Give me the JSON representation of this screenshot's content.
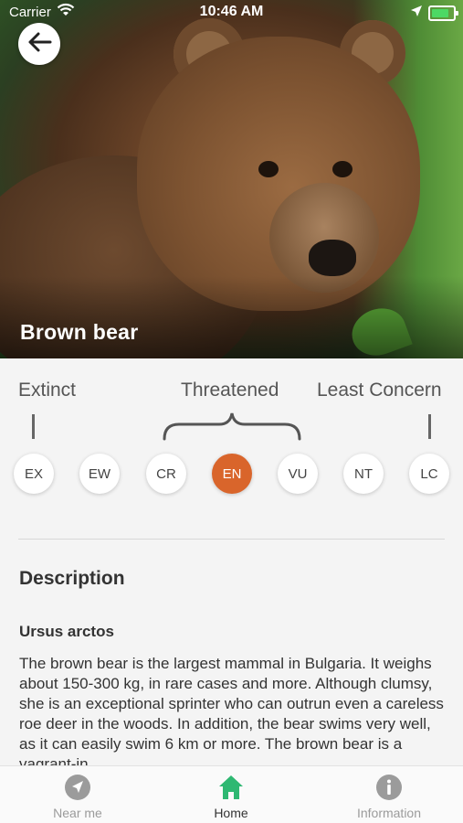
{
  "status_bar": {
    "carrier": "Carrier",
    "time": "10:46 AM"
  },
  "animal": {
    "name": "Brown bear",
    "latin_name": "Ursus arctos"
  },
  "scale": {
    "labels": {
      "extinct": "Extinct",
      "threatened": "Threatened",
      "least_concern": "Least Concern"
    },
    "categories": [
      "EX",
      "EW",
      "CR",
      "EN",
      "VU",
      "NT",
      "LC"
    ],
    "selected": "EN",
    "active_color": "#d9652b"
  },
  "description": {
    "heading": "Description",
    "text": "The brown bear is the largest mammal in Bulgaria. It weighs about 150-300 kg, in rare cases and more. Although clumsy, she is an exceptional sprinter who can outrun even a careless roe deer in the woods. In addition, the bear swims very well, as it can easily swim 6 km or more. The brown bear is a vagrant-in"
  },
  "tabbar": {
    "tabs": [
      {
        "label": "Near me",
        "icon": "navigation-arrow-icon"
      },
      {
        "label": "Home",
        "icon": "home-icon",
        "active": true
      },
      {
        "label": "Information",
        "icon": "info-icon"
      }
    ],
    "active_color": "#2eb872"
  }
}
